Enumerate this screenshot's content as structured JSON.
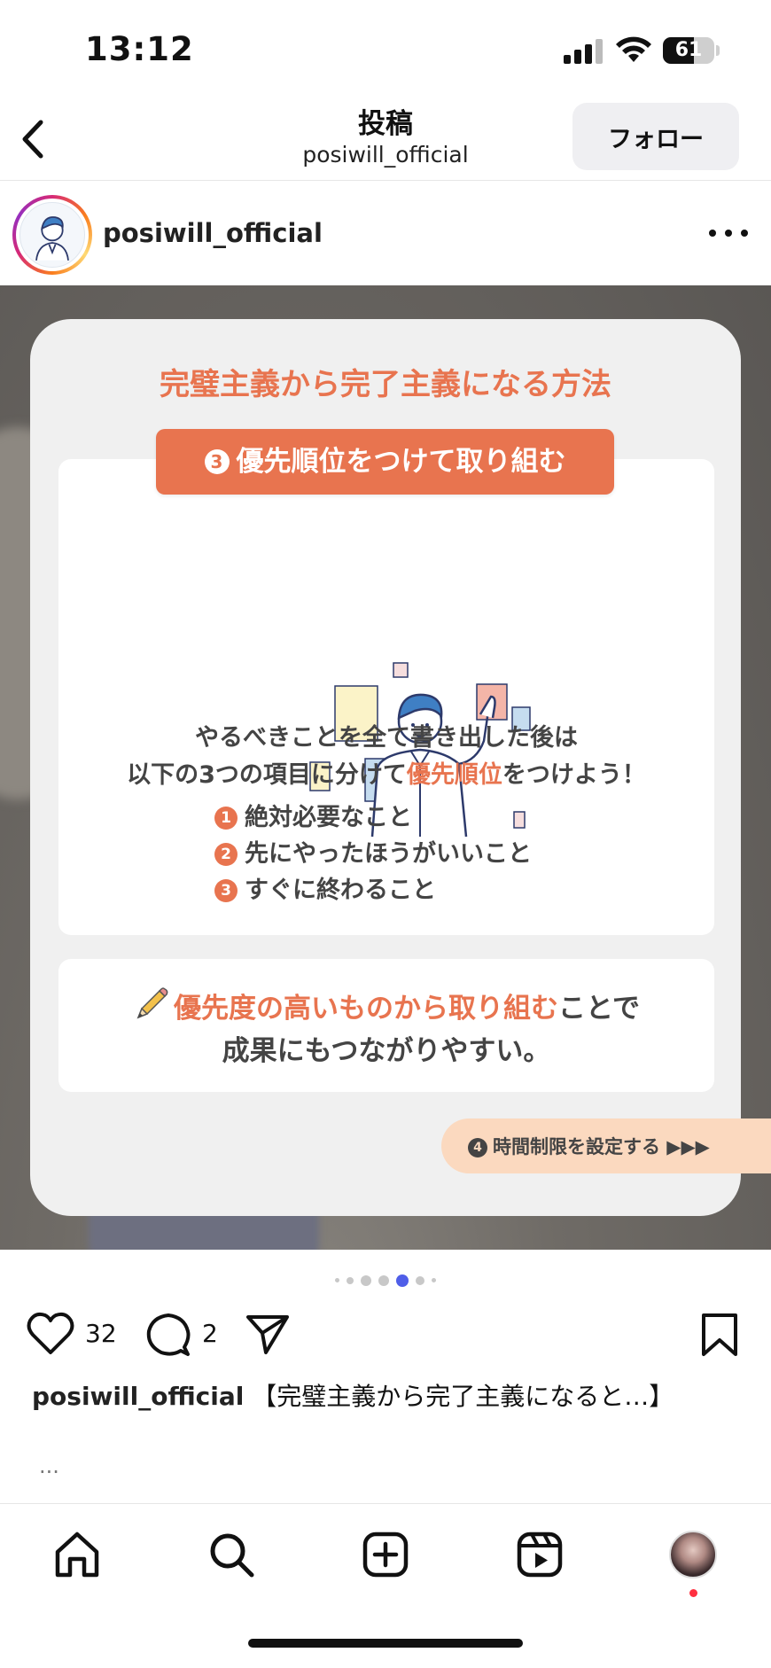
{
  "status_bar": {
    "time": "13:12",
    "battery": "61",
    "battery_level": 0.61
  },
  "header": {
    "title": "投稿",
    "subtitle": "posiwill_official",
    "follow_label": "フォロー"
  },
  "post": {
    "username": "posiwill_official",
    "slide": {
      "heading": "完璧主義から完了主義になる方法",
      "step_number": "3",
      "step_title": "優先順位をつけて取り組む",
      "body_line1": "やるべきことを全て書き出した後は",
      "body_line2_prefix": "以下の3つの項目に分けて",
      "body_line2_highlight": "優先順位",
      "body_line2_suffix": "をつけよう！",
      "items": [
        {
          "num": "1",
          "text": "絶対必要なこと"
        },
        {
          "num": "2",
          "text": "先にやったほうがいいこと"
        },
        {
          "num": "3",
          "text": "すぐに終わること"
        }
      ],
      "tip_highlight": "優先度の高いものから取り組む",
      "tip_suffix": "ことで",
      "tip_line2": "成果にもつながりやすい。",
      "next_num": "4",
      "next_label": "時間制限を設定する ▶▶▶"
    },
    "carousel": {
      "total": 7,
      "active_index": 4
    },
    "likes": "32",
    "comments": "2",
    "caption_user": "posiwill_official",
    "caption_text": "【完璧主義から完了主義になると…】",
    "more": "..."
  },
  "colors": {
    "accent": "#e8744f",
    "active_dot": "#4f5ee8",
    "notification": "#ff3040"
  },
  "icons": [
    "back-icon",
    "more-icon",
    "heart-icon",
    "comment-icon",
    "share-icon",
    "bookmark-icon",
    "home-icon",
    "search-icon",
    "create-icon",
    "reels-icon"
  ]
}
